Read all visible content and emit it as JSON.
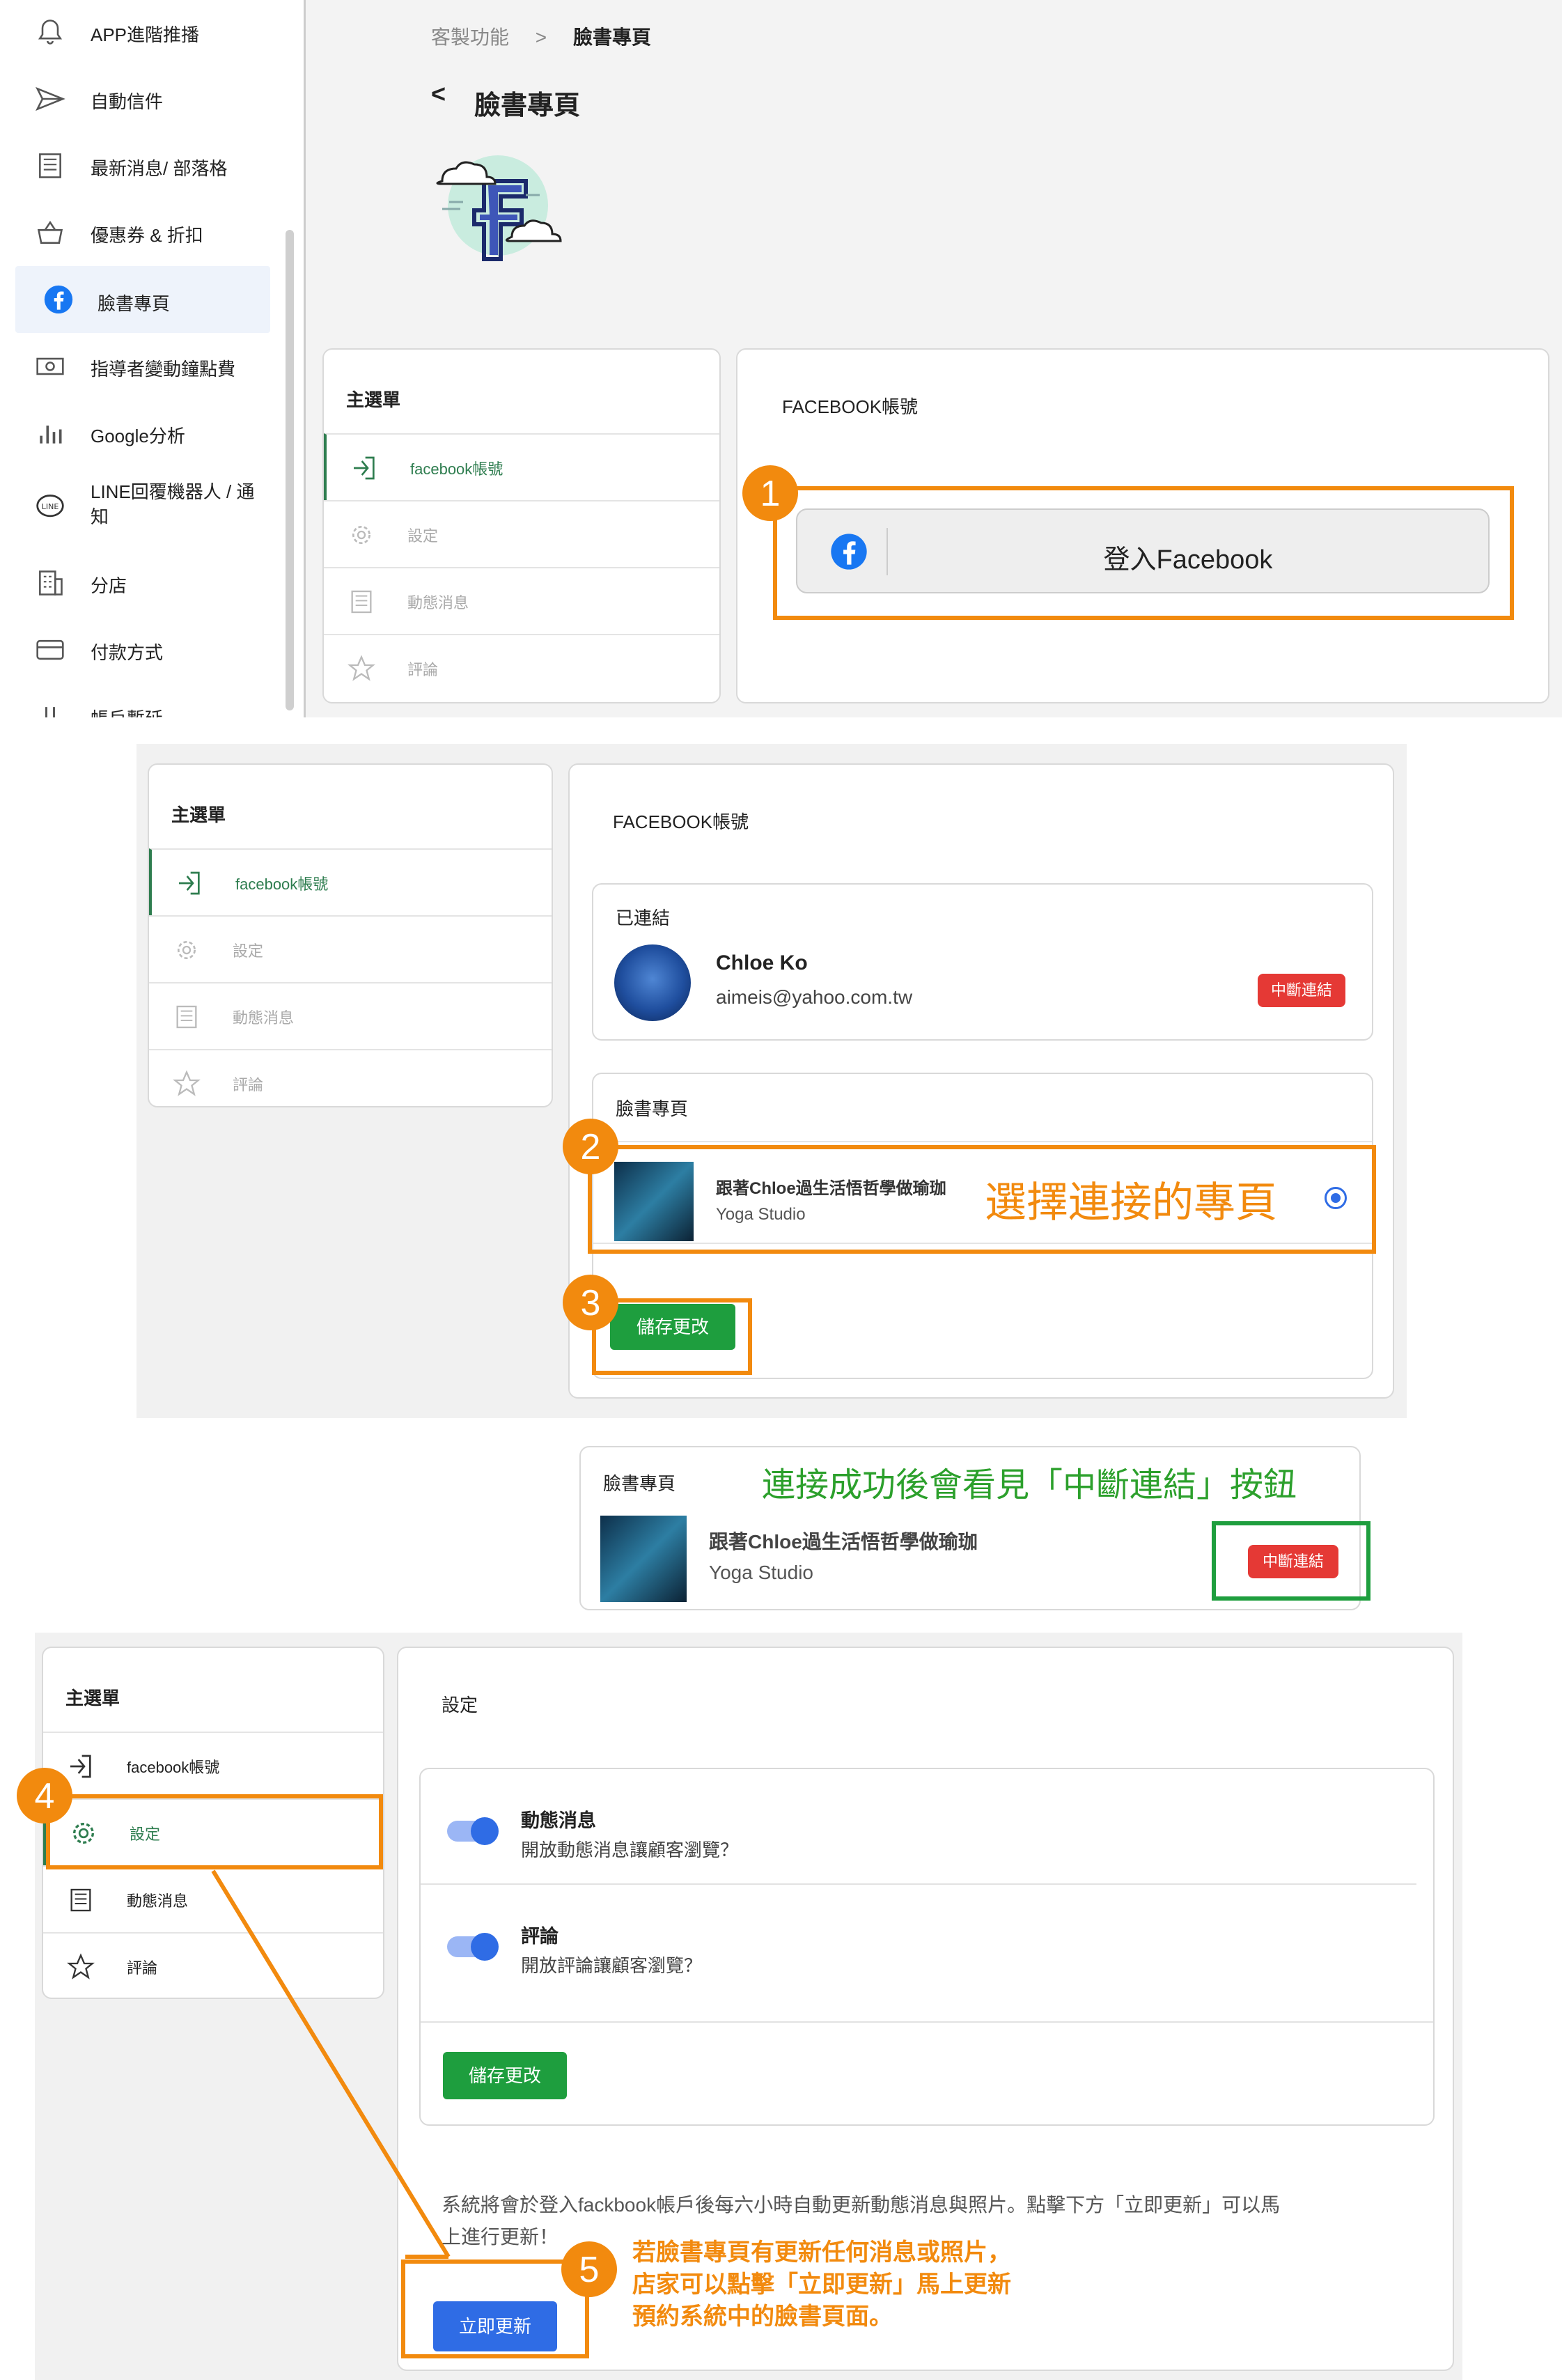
{
  "sidebar": {
    "items": [
      {
        "label": "APP進階推播",
        "icon": "bell-icon"
      },
      {
        "label": "自動信件",
        "icon": "send-icon"
      },
      {
        "label": "最新消息/ 部落格",
        "icon": "newspaper-icon"
      },
      {
        "label": "優惠券 & 折扣",
        "icon": "basket-icon"
      },
      {
        "label": "臉書專頁",
        "icon": "facebook-icon",
        "active": true
      },
      {
        "label": "指導者變動鐘點費",
        "icon": "money-icon"
      },
      {
        "label": "Google分析",
        "icon": "bar-chart-icon"
      },
      {
        "label": "LINE回覆機器人 / 通知",
        "icon": "line-icon"
      },
      {
        "label": "分店",
        "icon": "building-icon"
      },
      {
        "label": "付款方式",
        "icon": "card-icon"
      },
      {
        "label": "帳戶暫延",
        "icon": "pause-icon"
      }
    ]
  },
  "header": {
    "breadcrumb_parent": "客製功能",
    "breadcrumb_sep": ">",
    "breadcrumb_current": "臉書專頁",
    "back": "<",
    "title": "臉書專頁"
  },
  "menu": {
    "title": "主選單",
    "items": [
      "facebook帳號",
      "設定",
      "動態消息",
      "評論"
    ]
  },
  "panel1": {
    "title": "FACEBOOK帳號",
    "login_label": "登入Facebook"
  },
  "panel2": {
    "title": "FACEBOOK帳號",
    "connected_title": "已連結",
    "user_name": "Chloe Ko",
    "user_email": "aimeis@yahoo.com.tw",
    "disconnect": "中斷連結",
    "page_section_title": "臉書專頁",
    "page_name": "跟著Chloe過生活悟哲學做瑜珈",
    "page_sub": "Yoga Studio",
    "save": "儲存更改"
  },
  "panel3": {
    "title": "臉書專頁",
    "page_name": "跟著Chloe過生活悟哲學做瑜珈",
    "page_sub": "Yoga Studio",
    "disconnect": "中斷連結"
  },
  "panel4": {
    "title": "設定",
    "setting1_title": "動態消息",
    "setting1_desc": "開放動態消息讓顧客瀏覽？",
    "setting2_title": "評論",
    "setting2_desc": "開放評論讓顧客瀏覽？",
    "save": "儲存更改",
    "info_line1": "系統將會於登入fackbook帳戶後每六小時自動更新動態消息與照片。點擊下方「立即更新」可以馬",
    "info_line2": "上進行更新！",
    "update_now": "立即更新"
  },
  "annotations": {
    "step1": "1",
    "step2": "2",
    "step3": "3",
    "step4": "4",
    "step5": "5",
    "select_page": "選擇連接的專頁",
    "success_note": "連接成功後會看見「中斷連結」按鈕",
    "update_note_line1": "若臉書專頁有更新任何消息或照片，",
    "update_note_line2": "店家可以點擊「立即更新」馬上更新",
    "update_note_line3": "預約系統中的臉書頁面。"
  },
  "colors": {
    "orange": "#f28a0e",
    "green": "#1e9e3e",
    "red": "#e53935",
    "blue": "#2f6ce5",
    "facebook": "#1877f2",
    "note_green": "#2ca02c"
  }
}
